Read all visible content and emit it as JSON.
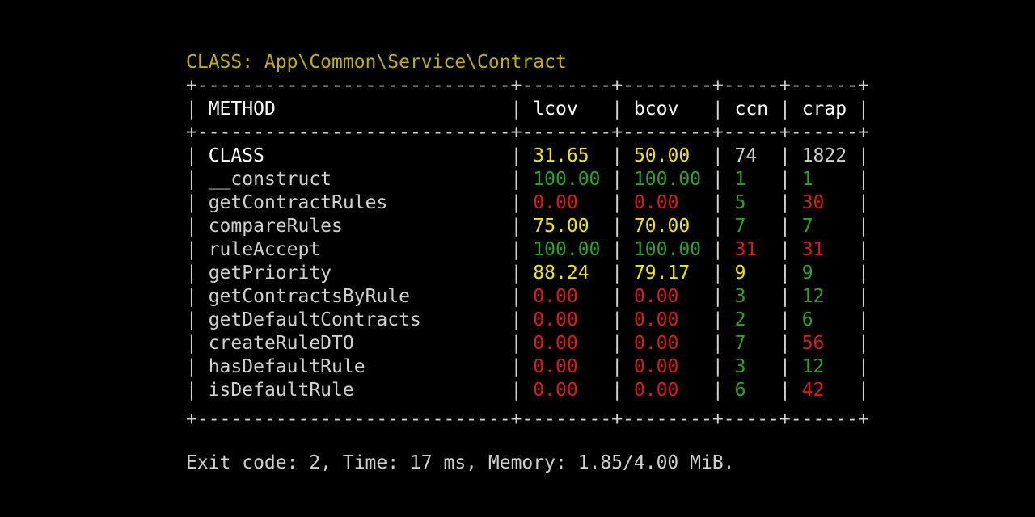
{
  "title": "CLASS: App\\Common\\Service\\Contract",
  "border": "+----------------------------+--------+--------+-----+------+",
  "headers": [
    "METHOD",
    "lcov",
    "bcov",
    "ccn",
    "crap"
  ],
  "rows": [
    {
      "method": "CLASS",
      "lcov": "31.65",
      "bcov": "50.00",
      "ccn": "74",
      "crap": "1822"
    },
    {
      "method": "__construct",
      "lcov": "100.00",
      "bcov": "100.00",
      "ccn": "1",
      "crap": "1"
    },
    {
      "method": "getContractRules",
      "lcov": "0.00",
      "bcov": "0.00",
      "ccn": "5",
      "crap": "30"
    },
    {
      "method": "compareRules",
      "lcov": "75.00",
      "bcov": "70.00",
      "ccn": "7",
      "crap": "7"
    },
    {
      "method": "ruleAccept",
      "lcov": "100.00",
      "bcov": "100.00",
      "ccn": "31",
      "crap": "31"
    },
    {
      "method": "getPriority",
      "lcov": "88.24",
      "bcov": "79.17",
      "ccn": "9",
      "crap": "9"
    },
    {
      "method": "getContractsByRule",
      "lcov": "0.00",
      "bcov": "0.00",
      "ccn": "3",
      "crap": "12"
    },
    {
      "method": "getDefaultContracts",
      "lcov": "0.00",
      "bcov": "0.00",
      "ccn": "2",
      "crap": "6"
    },
    {
      "method": "createRuleDTO",
      "lcov": "0.00",
      "bcov": "0.00",
      "ccn": "7",
      "crap": "56"
    },
    {
      "method": "hasDefaultRule",
      "lcov": "0.00",
      "bcov": "0.00",
      "ccn": "3",
      "crap": "12"
    },
    {
      "method": "isDefaultRule",
      "lcov": "0.00",
      "bcov": "0.00",
      "ccn": "6",
      "crap": "42"
    }
  ],
  "colors": {
    "title": "#c0b000",
    "yellow": "#f0e800",
    "green": "#22a822",
    "red": "#e01818",
    "text": "#d0d0d0"
  },
  "footer": "Exit code: 2, Time: 17 ms, Memory: 1.85/4.00 MiB."
}
